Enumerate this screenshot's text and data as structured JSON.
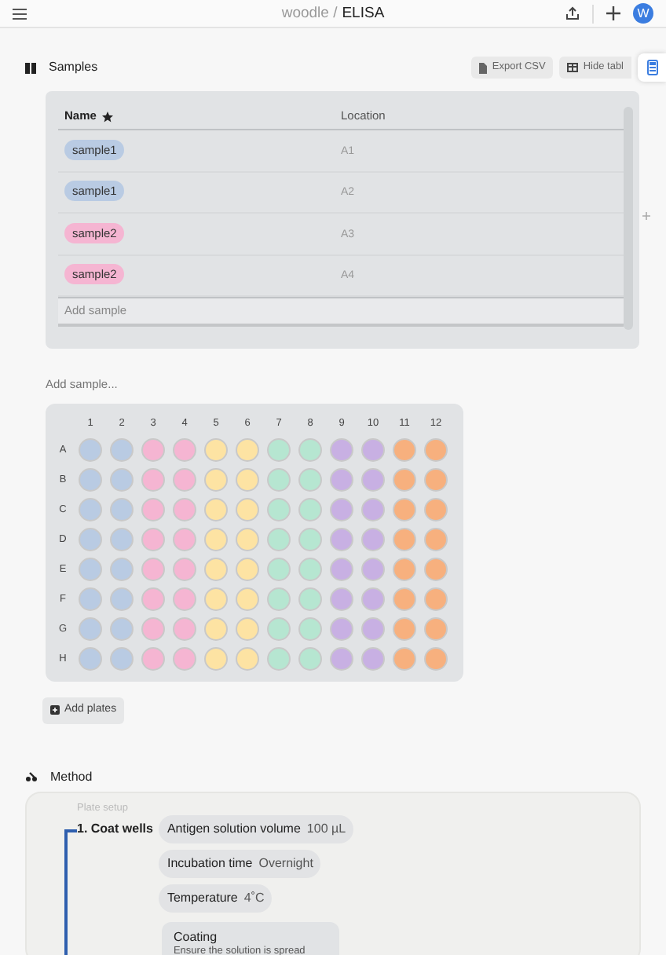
{
  "topbar": {
    "workspace": "woodle /",
    "title": "ELISA",
    "avatar": "W"
  },
  "samples": {
    "title": "Samples",
    "actions": [
      {
        "kind": "export",
        "label": "Export CSV"
      },
      {
        "kind": "table",
        "label": "Hide tabl"
      }
    ],
    "table": {
      "columns": [
        "Name",
        "Location"
      ],
      "rows": [
        {
          "name": "sample1",
          "color": "#b9cbe3",
          "location": "A1"
        },
        {
          "name": "sample1",
          "color": "#b9cbe3",
          "location": "A2"
        },
        {
          "name": "sample2",
          "color": "#f5b5d2",
          "location": "A3"
        },
        {
          "name": "sample2",
          "color": "#f5b5d2",
          "location": "A4"
        }
      ],
      "add_row": "Add sample"
    },
    "add_input": {
      "placeholder": "Add sample..."
    },
    "plate": {
      "rows": [
        "A",
        "B",
        "C",
        "D",
        "E",
        "F",
        "G",
        "H"
      ],
      "columns": [
        {
          "label": "1",
          "color": "#b9cbe3"
        },
        {
          "label": "2",
          "color": "#b9cbe3"
        },
        {
          "label": "3",
          "color": "#f5b5d2"
        },
        {
          "label": "4",
          "color": "#f5b5d2"
        },
        {
          "label": "5",
          "color": "#fde3a3"
        },
        {
          "label": "6",
          "color": "#fde3a3"
        },
        {
          "label": "7",
          "color": "#b6e6d1"
        },
        {
          "label": "8",
          "color": "#b6e6d1"
        },
        {
          "label": "9",
          "color": "#c8b0e3"
        },
        {
          "label": "10",
          "color": "#c8b0e3"
        },
        {
          "label": "11",
          "color": "#f7b07e"
        },
        {
          "label": "12",
          "color": "#f7b07e"
        }
      ]
    },
    "add_plates": "Add plates"
  },
  "method": {
    "title": "Method",
    "steps": [
      {
        "group": "Plate setup",
        "title": "1. Coat wells",
        "params": [
          {
            "label": "Antigen solution volume",
            "value": "100 µL"
          },
          {
            "label": "Incubation time",
            "value": "Overnight"
          },
          {
            "label": "Temperature",
            "value": "4˚C"
          }
        ],
        "note": {
          "title": "Coating",
          "text": "Ensure the solution is spread"
        }
      }
    ]
  }
}
